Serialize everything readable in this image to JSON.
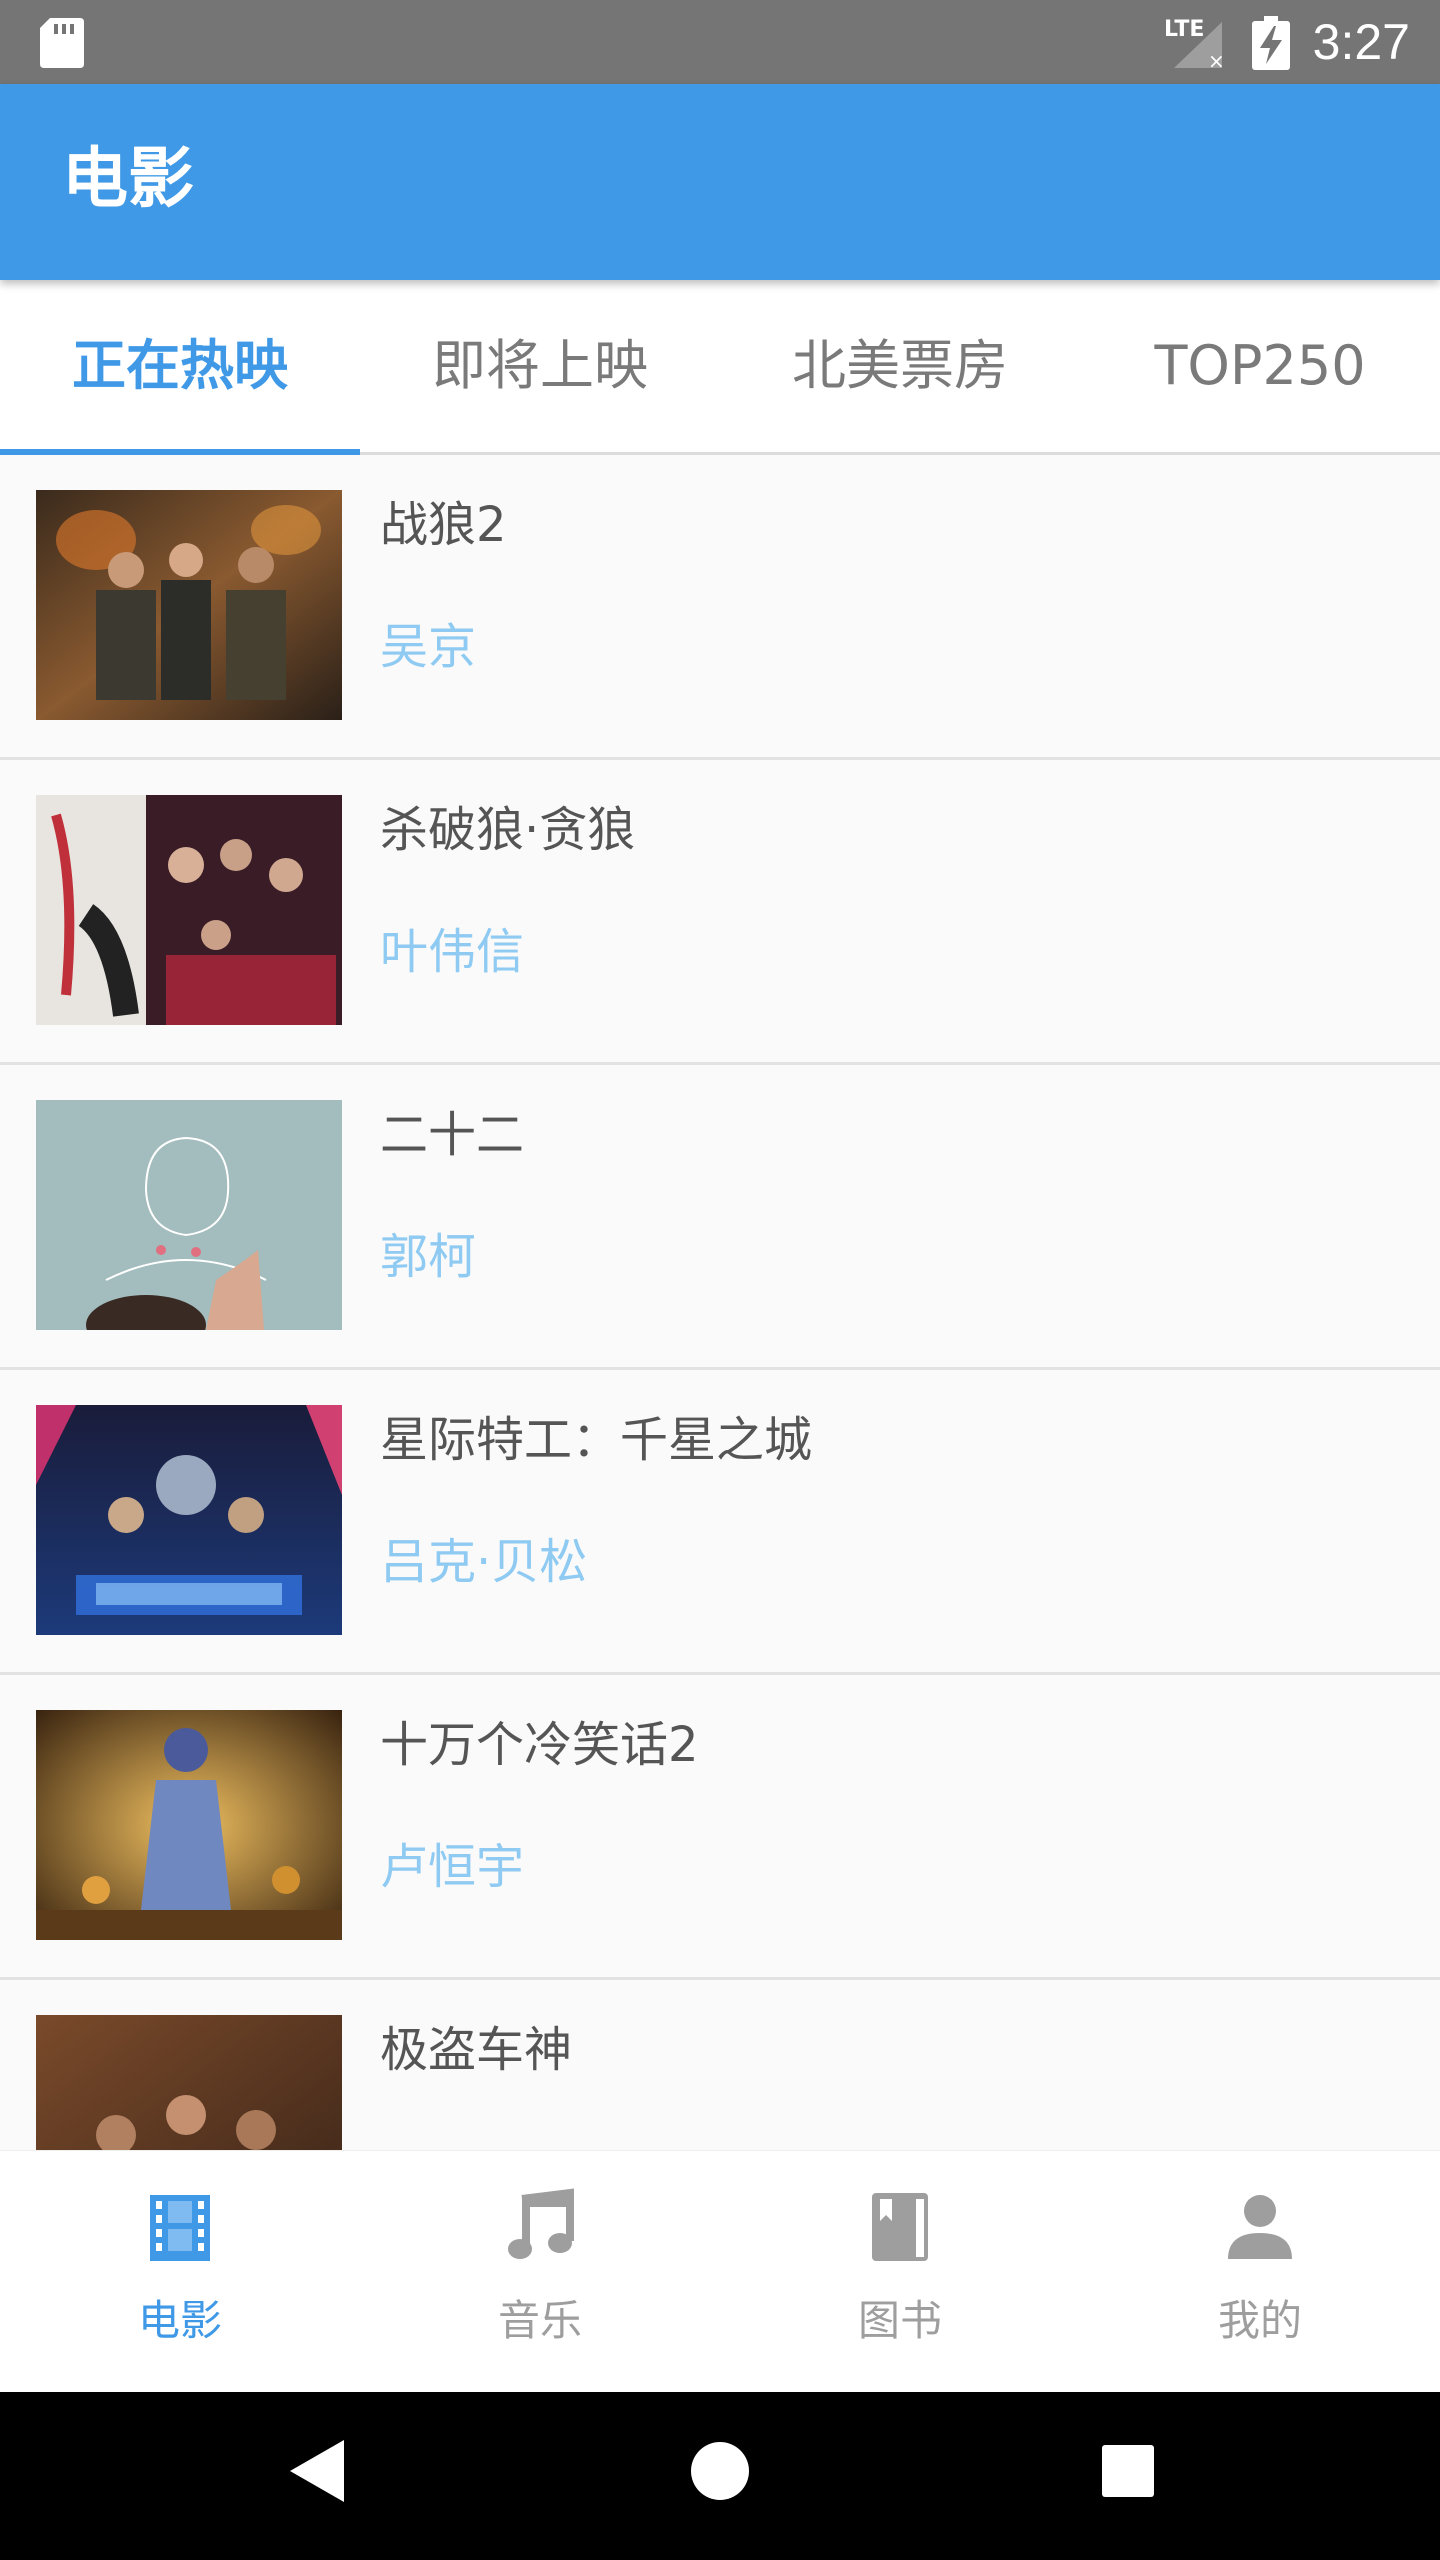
{
  "status_bar": {
    "time": "3:27",
    "network": "LTE"
  },
  "app_bar": {
    "title": "电影"
  },
  "tabs": [
    {
      "label": "正在热映",
      "active": true
    },
    {
      "label": "即将上映",
      "active": false
    },
    {
      "label": "北美票房",
      "active": false
    },
    {
      "label": "TOP250",
      "active": false
    }
  ],
  "movies": [
    {
      "title": "战狼2",
      "director": "吴京"
    },
    {
      "title": "杀破狼·贪狼",
      "director": "叶伟信"
    },
    {
      "title": "二十二",
      "director": "郭柯"
    },
    {
      "title": "星际特工：千星之城",
      "director": "吕克·贝松"
    },
    {
      "title": "十万个冷笑话2",
      "director": "卢恒宇"
    },
    {
      "title": "极盗车神",
      "director": ""
    }
  ],
  "bottom_nav": [
    {
      "label": "电影",
      "icon": "movie-film-icon",
      "active": true
    },
    {
      "label": "音乐",
      "icon": "music-note-icon",
      "active": false
    },
    {
      "label": "图书",
      "icon": "book-icon",
      "active": false
    },
    {
      "label": "我的",
      "icon": "person-icon",
      "active": false
    }
  ],
  "colors": {
    "primary": "#3f99e6",
    "director_text": "#8ecaf2",
    "inactive": "#9e9e9e"
  }
}
